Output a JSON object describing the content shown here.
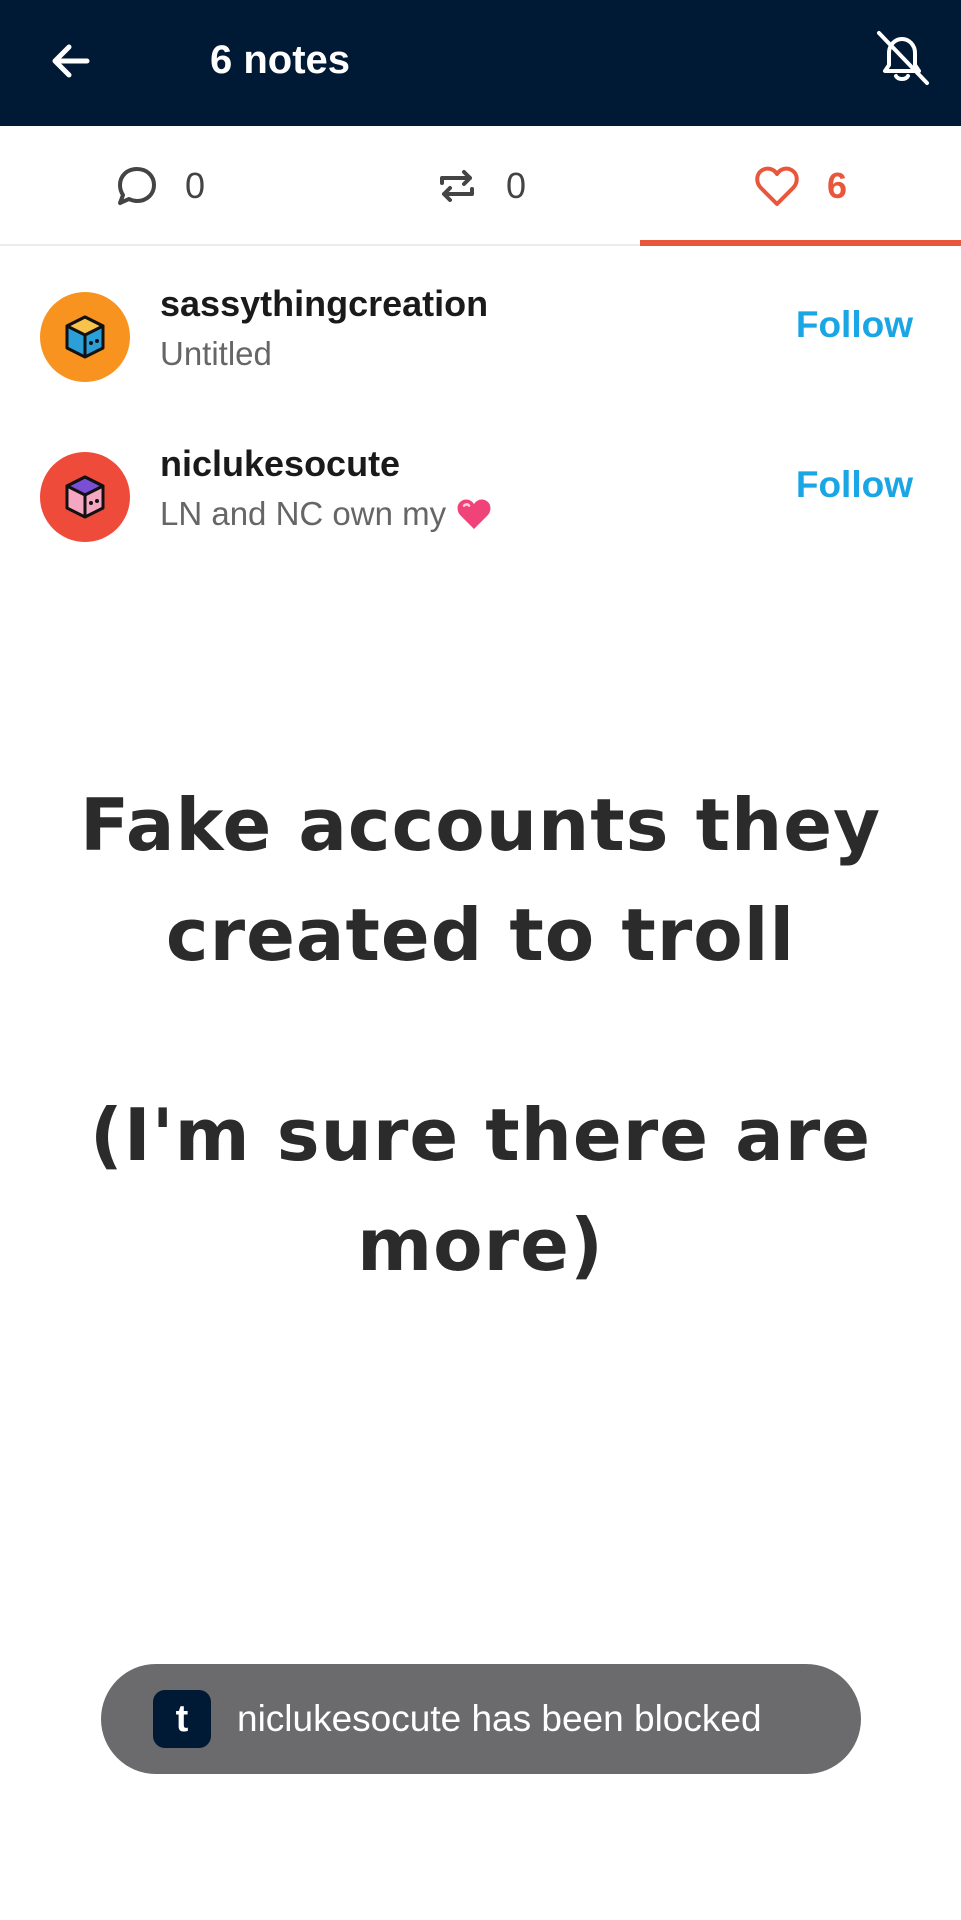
{
  "header": {
    "title": "6 notes",
    "back_icon": "arrow-left-icon",
    "mute_icon": "bell-off-icon",
    "background": "#001935"
  },
  "tabs": [
    {
      "icon": "reply-icon",
      "count": "0",
      "active": false
    },
    {
      "icon": "reblog-icon",
      "count": "0",
      "active": false
    },
    {
      "icon": "heart-icon",
      "count": "6",
      "active": true
    }
  ],
  "accent_color": "#e8563b",
  "notes": [
    {
      "username": "sassythingcreation",
      "subtitle": "Untitled",
      "subtitle_emoji": "",
      "avatar_color": "#f7931e",
      "follow_label": "Follow"
    },
    {
      "username": "niclukesocute",
      "subtitle": "LN and NC own my",
      "subtitle_emoji": "heart-emoji",
      "avatar_color": "#ef4b3a",
      "follow_label": "Follow"
    }
  ],
  "overlay": {
    "line1": "Fake accounts they",
    "line2": "created to troll",
    "line3": "(I'm sure there are",
    "line4": "more)"
  },
  "toast": {
    "logo_letter": "t",
    "message": "niclukesocute has been blocked"
  }
}
